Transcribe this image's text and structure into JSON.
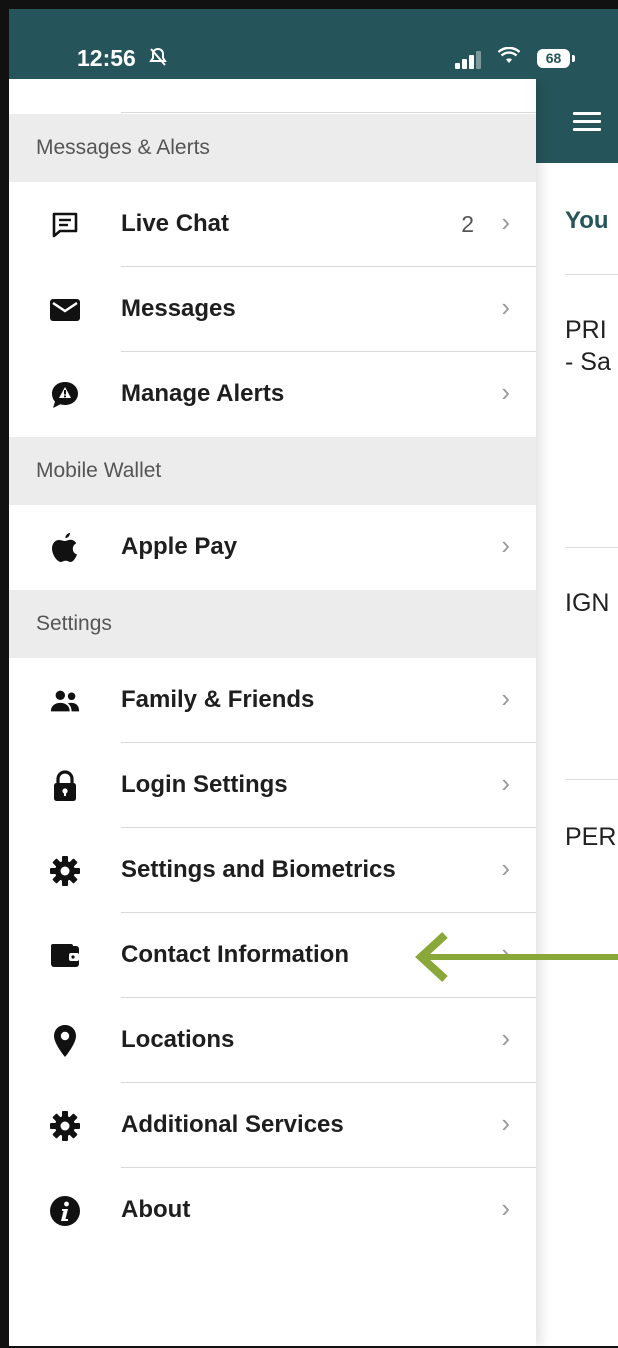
{
  "status_bar": {
    "time": "12:56",
    "battery": "68"
  },
  "under": {
    "you_label": "You",
    "row1": "PRI\n- Sa",
    "row2": "IGN",
    "row3": "PER"
  },
  "drawer": {
    "sections": [
      {
        "title": "Messages & Alerts"
      },
      {
        "title": "Mobile Wallet"
      },
      {
        "title": "Settings"
      }
    ],
    "items": [
      {
        "label": "Live Chat",
        "count": "2",
        "icon": "chat-icon"
      },
      {
        "label": "Messages",
        "icon": "envelope-icon"
      },
      {
        "label": "Manage Alerts",
        "icon": "alert-icon"
      },
      {
        "label": "Apple Pay",
        "icon": "apple-icon"
      },
      {
        "label": "Family & Friends",
        "icon": "people-icon"
      },
      {
        "label": "Login Settings",
        "icon": "lock-icon"
      },
      {
        "label": "Settings and Biometrics",
        "icon": "gear-icon"
      },
      {
        "label": "Contact Information",
        "icon": "wallet-icon"
      },
      {
        "label": "Locations",
        "icon": "location-pin-icon"
      },
      {
        "label": "Additional Services",
        "icon": "gear-icon"
      },
      {
        "label": "About",
        "icon": "info-icon"
      }
    ],
    "chevron": "›"
  },
  "colors": {
    "brand": "#25555a",
    "arrow": "#8aa83a"
  }
}
